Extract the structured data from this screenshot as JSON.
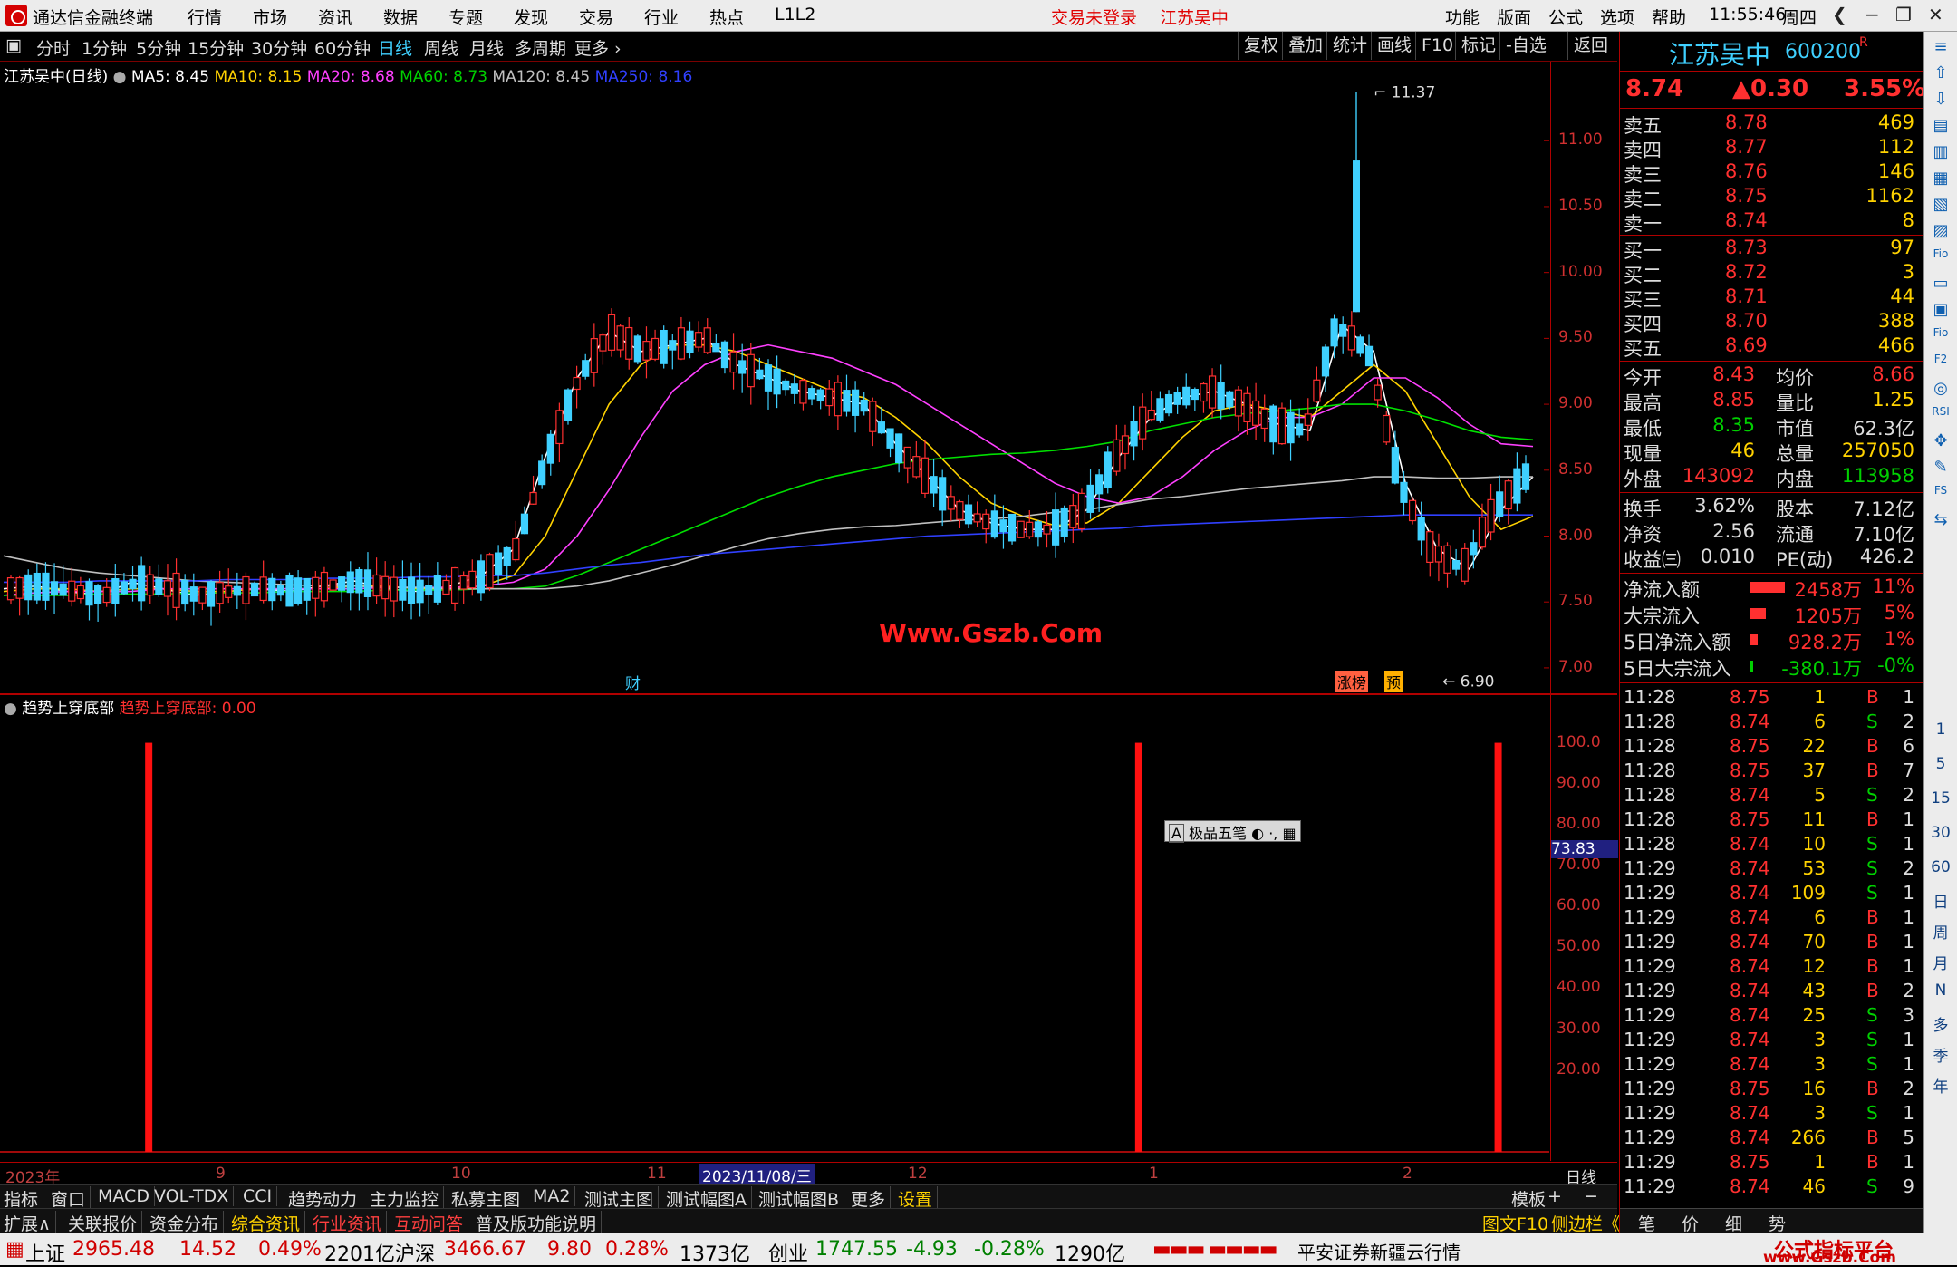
{
  "menubar": {
    "app_title": "通达信金融终端",
    "items": [
      "行情",
      "市场",
      "资讯",
      "数据",
      "专题",
      "发现",
      "交易",
      "行业",
      "热点",
      "L1L2"
    ],
    "login_status": "交易未登录",
    "stock_title": "江苏吴中",
    "right_items": [
      "功能",
      "版面",
      "公式",
      "选项",
      "帮助"
    ],
    "clock": "11:55:46",
    "weekday": "周四"
  },
  "toolbar": {
    "periods": [
      "分时",
      "1分钟",
      "5分钟",
      "15分钟",
      "30分钟",
      "60分钟",
      "日线",
      "周线",
      "月线",
      "多周期",
      "更多"
    ],
    "active_period": "日线",
    "right_buttons": [
      "复权",
      "叠加",
      "统计",
      "画线",
      "F10",
      "标记",
      "-自选",
      "返回"
    ]
  },
  "chart_header": {
    "name": "江苏吴中(日线)",
    "ma5": "MA5: 8.45",
    "ma10": "MA10: 8.15",
    "ma20": "MA20: 8.68",
    "ma60": "MA60: 8.73",
    "ma120": "MA120: 8.45",
    "ma250": "MA250: 8.16"
  },
  "chart_labels": {
    "high_label": "11.37",
    "low_label": "6.90",
    "watermark": "Www.Gszb.Com",
    "marker_cai": "财",
    "marker_zhangbang": "涨榜",
    "marker_yu": "预",
    "ime": "极品五笔"
  },
  "chart_data": [
    {
      "type": "line",
      "title": "江苏吴中(日线)",
      "ylim": [
        6.8,
        11.6
      ],
      "yticks": [
        "11.00",
        "10.50",
        "10.00",
        "9.50",
        "9.00",
        "8.50",
        "8.00",
        "7.50",
        "7.00"
      ],
      "series": [
        {
          "name": "MA5",
          "color": "#ffffff",
          "values": [
            7.6,
            7.62,
            7.58,
            7.55,
            7.65,
            7.6,
            7.55,
            7.58,
            7.6,
            7.58,
            7.62,
            7.66,
            7.6,
            7.58,
            7.62,
            7.7,
            7.9,
            8.6,
            9.2,
            9.55,
            9.4,
            9.45,
            9.5,
            9.3,
            9.2,
            9.1,
            9.05,
            9.0,
            8.7,
            8.45,
            8.2,
            8.1,
            8.05,
            8.05,
            8.2,
            8.6,
            8.9,
            9.05,
            9.1,
            9.0,
            8.85,
            8.8,
            9.6,
            9.4,
            8.4,
            7.9,
            7.75,
            8.2,
            8.45
          ]
        },
        {
          "name": "MA10",
          "color": "#ffd200",
          "values": [
            7.58,
            7.6,
            7.6,
            7.58,
            7.6,
            7.6,
            7.58,
            7.58,
            7.6,
            7.6,
            7.6,
            7.62,
            7.62,
            7.6,
            7.6,
            7.62,
            7.7,
            8.0,
            8.5,
            9.0,
            9.3,
            9.45,
            9.45,
            9.4,
            9.3,
            9.2,
            9.1,
            9.05,
            8.9,
            8.7,
            8.45,
            8.25,
            8.15,
            8.08,
            8.1,
            8.25,
            8.5,
            8.75,
            8.95,
            9.0,
            8.95,
            8.9,
            9.1,
            9.3,
            9.1,
            8.7,
            8.3,
            8.05,
            8.15
          ]
        },
        {
          "name": "MA20",
          "color": "#ff40ff",
          "values": [
            7.55,
            7.57,
            7.58,
            7.58,
            7.58,
            7.6,
            7.6,
            7.6,
            7.6,
            7.6,
            7.6,
            7.6,
            7.61,
            7.61,
            7.61,
            7.62,
            7.65,
            7.75,
            8.0,
            8.35,
            8.75,
            9.1,
            9.3,
            9.4,
            9.45,
            9.4,
            9.35,
            9.25,
            9.15,
            9.0,
            8.85,
            8.7,
            8.55,
            8.4,
            8.3,
            8.25,
            8.3,
            8.45,
            8.65,
            8.8,
            8.9,
            8.9,
            9.0,
            9.2,
            9.2,
            9.05,
            8.85,
            8.7,
            8.68
          ]
        },
        {
          "name": "MA60",
          "color": "#00e000",
          "values": [
            7.55,
            7.55,
            7.55,
            7.56,
            7.56,
            7.56,
            7.57,
            7.57,
            7.57,
            7.58,
            7.58,
            7.58,
            7.59,
            7.59,
            7.59,
            7.6,
            7.6,
            7.62,
            7.7,
            7.8,
            7.9,
            8.0,
            8.1,
            8.2,
            8.3,
            8.38,
            8.45,
            8.5,
            8.55,
            8.58,
            8.6,
            8.62,
            8.63,
            8.65,
            8.68,
            8.72,
            8.8,
            8.85,
            8.9,
            8.93,
            8.95,
            8.97,
            9.0,
            9.0,
            8.95,
            8.88,
            8.8,
            8.75,
            8.73
          ]
        },
        {
          "name": "MA120",
          "color": "#c0c0c0",
          "values": [
            7.85,
            7.8,
            7.75,
            7.72,
            7.7,
            7.68,
            7.66,
            7.65,
            7.64,
            7.63,
            7.62,
            7.62,
            7.61,
            7.61,
            7.6,
            7.6,
            7.6,
            7.6,
            7.62,
            7.66,
            7.72,
            7.78,
            7.85,
            7.92,
            7.98,
            8.02,
            8.05,
            8.07,
            8.08,
            8.1,
            8.12,
            8.13,
            8.15,
            8.18,
            8.2,
            8.24,
            8.28,
            8.3,
            8.33,
            8.36,
            8.38,
            8.4,
            8.42,
            8.45,
            8.45,
            8.44,
            8.44,
            8.45,
            8.45
          ]
        },
        {
          "name": "MA250",
          "color": "#3040ff",
          "values": [
            7.65,
            7.65,
            7.65,
            7.66,
            7.66,
            7.66,
            7.66,
            7.67,
            7.67,
            7.67,
            7.68,
            7.68,
            7.68,
            7.69,
            7.69,
            7.7,
            7.7,
            7.72,
            7.75,
            7.78,
            7.8,
            7.83,
            7.86,
            7.88,
            7.9,
            7.92,
            7.94,
            7.96,
            7.98,
            8.0,
            8.01,
            8.02,
            8.03,
            8.04,
            8.05,
            8.06,
            8.08,
            8.09,
            8.1,
            8.11,
            8.12,
            8.13,
            8.14,
            8.15,
            8.16,
            8.16,
            8.16,
            8.16,
            8.16
          ]
        }
      ]
    },
    {
      "type": "bar",
      "title": "趋势上穿底部",
      "ylim": [
        0,
        105
      ],
      "yticks": [
        "100.0",
        "90.00",
        "80.00",
        "70.00",
        "60.00",
        "50.00",
        "40.00",
        "30.00",
        "20.00"
      ],
      "current_value_label": "73.83",
      "series": [
        {
          "name": "趋势上穿底部",
          "values": [
            {
              "x": 0.096,
              "v": 100
            },
            {
              "x": 0.735,
              "v": 100
            },
            {
              "x": 0.967,
              "v": 100
            }
          ]
        }
      ]
    }
  ],
  "indicator": {
    "name": "趋势上穿底部",
    "value": "趋势上穿底部: 0.00"
  },
  "quote": {
    "name": "江苏吴中",
    "code": "600200",
    "flag": "R",
    "price": "8.74",
    "change": "▲0.30",
    "pct": "3.55%",
    "asks": [
      {
        "label": "卖五",
        "price": "8.78",
        "vol": "469"
      },
      {
        "label": "卖四",
        "price": "8.77",
        "vol": "112"
      },
      {
        "label": "卖三",
        "price": "8.76",
        "vol": "146"
      },
      {
        "label": "卖二",
        "price": "8.75",
        "vol": "1162"
      },
      {
        "label": "卖一",
        "price": "8.74",
        "vol": "8"
      }
    ],
    "bids": [
      {
        "label": "买一",
        "price": "8.73",
        "vol": "97"
      },
      {
        "label": "买二",
        "price": "8.72",
        "vol": "3"
      },
      {
        "label": "买三",
        "price": "8.71",
        "vol": "44"
      },
      {
        "label": "买四",
        "price": "8.70",
        "vol": "388"
      },
      {
        "label": "买五",
        "price": "8.69",
        "vol": "466"
      }
    ],
    "stats1": [
      {
        "l1": "今开",
        "v1": "8.43",
        "l2": "均价",
        "v2": "8.66"
      },
      {
        "l1": "最高",
        "v1": "8.85",
        "l2": "量比",
        "v2": "1.25"
      },
      {
        "l1": "最低",
        "v1": "8.35",
        "l2": "市值",
        "v2": "62.3亿"
      },
      {
        "l1": "现量",
        "v1": "46",
        "l2": "总量",
        "v2": "257050"
      },
      {
        "l1": "外盘",
        "v1": "143092",
        "l2": "内盘",
        "v2": "113958"
      }
    ],
    "stats2": [
      {
        "l1": "换手",
        "v1": "3.62%",
        "l2": "股本",
        "v2": "7.12亿"
      },
      {
        "l1": "净资",
        "v1": "2.56",
        "l2": "流通",
        "v2": "7.10亿"
      },
      {
        "l1": "收益㈢",
        "v1": "0.010",
        "l2": "PE(动)",
        "v2": "426.2"
      }
    ],
    "flows": [
      {
        "label": "净流入额",
        "value": "2458万",
        "pct": "11%",
        "bar": 1.0
      },
      {
        "label": "大宗流入",
        "value": "1205万",
        "pct": "5%",
        "bar": 0.45
      },
      {
        "label": "5日净流入额",
        "value": "928.2万",
        "pct": "1%",
        "bar": 0.2
      },
      {
        "label": "5日大宗流入",
        "value": "-380.1万",
        "pct": "-0%",
        "bar": 0.05
      }
    ],
    "ticks": [
      {
        "t": "11:28",
        "p": "8.75",
        "v": "1",
        "d": "B",
        "n": "1"
      },
      {
        "t": "11:28",
        "p": "8.74",
        "v": "6",
        "d": "S",
        "n": "2"
      },
      {
        "t": "11:28",
        "p": "8.75",
        "v": "22",
        "d": "B",
        "n": "6"
      },
      {
        "t": "11:28",
        "p": "8.75",
        "v": "37",
        "d": "B",
        "n": "7"
      },
      {
        "t": "11:28",
        "p": "8.74",
        "v": "5",
        "d": "S",
        "n": "2"
      },
      {
        "t": "11:28",
        "p": "8.75",
        "v": "11",
        "d": "B",
        "n": "1"
      },
      {
        "t": "11:28",
        "p": "8.74",
        "v": "10",
        "d": "S",
        "n": "1"
      },
      {
        "t": "11:29",
        "p": "8.74",
        "v": "53",
        "d": "S",
        "n": "2"
      },
      {
        "t": "11:29",
        "p": "8.74",
        "v": "109",
        "d": "S",
        "n": "1"
      },
      {
        "t": "11:29",
        "p": "8.74",
        "v": "6",
        "d": "B",
        "n": "1"
      },
      {
        "t": "11:29",
        "p": "8.74",
        "v": "70",
        "d": "B",
        "n": "1"
      },
      {
        "t": "11:29",
        "p": "8.74",
        "v": "12",
        "d": "B",
        "n": "1"
      },
      {
        "t": "11:29",
        "p": "8.74",
        "v": "43",
        "d": "B",
        "n": "2"
      },
      {
        "t": "11:29",
        "p": "8.74",
        "v": "25",
        "d": "S",
        "n": "3"
      },
      {
        "t": "11:29",
        "p": "8.74",
        "v": "3",
        "d": "S",
        "n": "1"
      },
      {
        "t": "11:29",
        "p": "8.74",
        "v": "3",
        "d": "S",
        "n": "1"
      },
      {
        "t": "11:29",
        "p": "8.75",
        "v": "16",
        "d": "B",
        "n": "2"
      },
      {
        "t": "11:29",
        "p": "8.74",
        "v": "3",
        "d": "S",
        "n": "1"
      },
      {
        "t": "11:29",
        "p": "8.74",
        "v": "266",
        "d": "B",
        "n": "5"
      },
      {
        "t": "11:29",
        "p": "8.75",
        "v": "1",
        "d": "B",
        "n": "1"
      },
      {
        "t": "11:29",
        "p": "8.74",
        "v": "46",
        "d": "S",
        "n": "9"
      }
    ]
  },
  "rightbar": [
    "1",
    "5",
    "15",
    "30",
    "60",
    "日",
    "周",
    "月",
    "N",
    "多",
    "季",
    "年"
  ],
  "datebar": {
    "labels": [
      "2023年",
      "9",
      "10",
      "11",
      "12",
      "1",
      "2"
    ],
    "cursor_date": "2023/11/08/三",
    "period": "日线"
  },
  "tabs1": [
    "指标",
    "窗口",
    "MACD",
    "VOL-TDX",
    "CCI",
    "趋势动力",
    "主力监控",
    "私募主图",
    "MA2",
    "测试主图",
    "测试幅图A",
    "测试幅图B",
    "更多",
    "设置"
  ],
  "tabs1_active": "设置",
  "tabs1_right": [
    "模板",
    "+",
    "−"
  ],
  "tabs2": [
    "扩展∧",
    "关联报价",
    "资金分布",
    "综合资讯",
    "行业资讯",
    "互动问答",
    "普及版功能说明"
  ],
  "tabs2_right": "图文F10",
  "tabs2_right2": "侧边栏《",
  "quote_tabs": [
    "笔",
    "价",
    "细",
    "势"
  ],
  "status": {
    "sh_name": "上证",
    "sh_val": "2965.48",
    "sh_chg": "14.52",
    "sh_pct": "0.49%",
    "sh_amt": "2201亿",
    "hs_name": "沪深",
    "hs_val": "3466.67",
    "hs_chg": "9.80",
    "hs_pct": "0.28%",
    "hs_amt": "1373亿",
    "cy_name": "创业",
    "cy_val": "1747.55",
    "cy_chg": "-4.93",
    "cy_pct": "-0.28%",
    "cy_amt": "1290亿",
    "broker": "平安证券新疆云行情",
    "brand": "公式指标平台",
    "brand_url": "www.Gszb.Com"
  }
}
